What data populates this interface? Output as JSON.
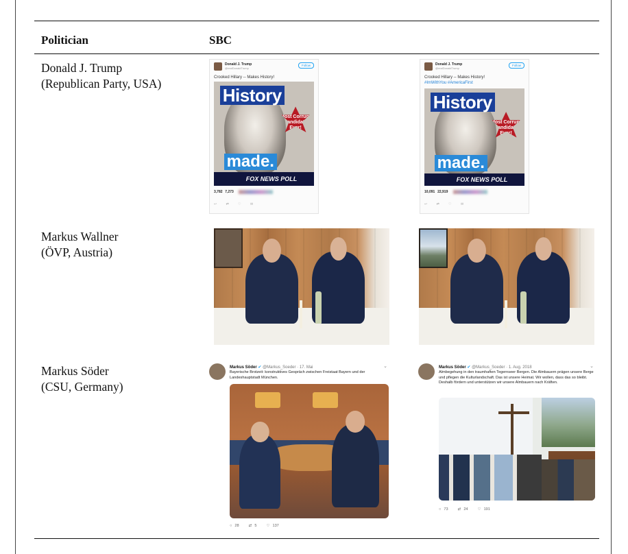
{
  "table": {
    "headers": {
      "politician": "Politician",
      "sbc": "SBC"
    },
    "rows": [
      {
        "politician": {
          "line1": "Donald J. Trump",
          "line2": "(Republican Party, USA)"
        },
        "left": {
          "name": "Donald J. Trump",
          "handle": "@realDonaldTrump",
          "follow": "Follow",
          "text": "Crooked Hillary -- Makes History!",
          "poster": {
            "headline": "History",
            "star": "Most Corrupt Candidate Ever!",
            "sub": "made.",
            "banner": "FOX NEWS POLL"
          },
          "stats": {
            "retweets": "3,782",
            "likes": "7,273"
          }
        },
        "right": {
          "name": "Donald J. Trump",
          "handle": "@realDonaldTrump",
          "follow": "Follow",
          "text": "Crooked Hillary -- Makes History!",
          "tags": "#ImWithYou #AmericaFirst",
          "poster": {
            "headline": "History",
            "star": "Most Corrupt Candidate Ever!",
            "sub": "made.",
            "banner": "FOX NEWS POLL"
          },
          "stats": {
            "retweets": "10,091",
            "likes": "22,919"
          }
        }
      },
      {
        "politician": {
          "line1": "Markus Wallner",
          "line2": "(ÖVP, Austria)"
        }
      },
      {
        "politician": {
          "line1": "Markus Söder",
          "line2": "(CSU, Germany)"
        },
        "left": {
          "name": "Markus Söder",
          "handle": "@Markus_Soeder · 17. Mai",
          "text": "Bayerische Brotzeit: konstruktives Gespräch zwischen Freistaat Bayern und der Landeshauptstadt München.",
          "actions": {
            "replies": "28",
            "retweets": "5",
            "likes": "137"
          }
        },
        "right": {
          "name": "Markus Söder",
          "handle": "@Markus_Soeder · 1. Aug. 2018",
          "text": "Almbegehung in den traumhaften Tegernseer Bergen. Die Almbauern prägen unsere Berge und pflegen die Kulturlandschaft. Das ist unsere Heimat. Wir wollen, dass das so bleibt. Deshalb fördern und unterstützen wir unsere Almbauern nach Kräften.",
          "actions": {
            "replies": "73",
            "retweets": "24",
            "likes": "191"
          }
        }
      }
    ]
  }
}
